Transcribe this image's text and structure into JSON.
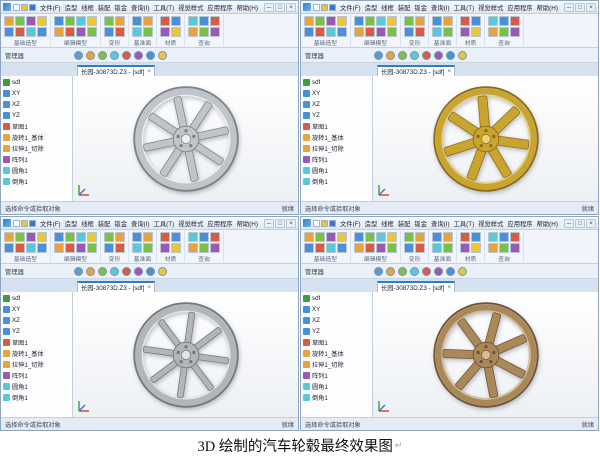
{
  "caption": {
    "text": "3D 绘制的汽车轮毂最终效果图",
    "mark": "↵"
  },
  "app": {
    "menus": [
      "文件(F)",
      "造型",
      "线框",
      "装配",
      "钣金",
      "查询(I)",
      "工具(T)",
      "视觉样式",
      "应用程序",
      "帮助(H)"
    ],
    "quick_icons": [
      {
        "name": "new-file-icon",
        "color": "#ffffff"
      },
      {
        "name": "open-file-icon",
        "color": "#f0c040"
      },
      {
        "name": "save-icon",
        "color": "#3a78c9"
      }
    ],
    "window_buttons": [
      "─",
      "□",
      "×"
    ],
    "ribbon": {
      "groups": [
        {
          "label": "基础造型",
          "icon_colors": [
            "#e8a33d",
            "#4a90d9",
            "#7ac143",
            "#d95b43",
            "#9b59b6",
            "#5bc8d9",
            "#e8c63d",
            "#4a90d9"
          ]
        },
        {
          "label": "编辑模型",
          "icon_colors": [
            "#4a90d9",
            "#e8a33d",
            "#7ac143",
            "#d95b43",
            "#5bc8d9",
            "#9b59b6",
            "#e8c63d",
            "#7ac143"
          ]
        },
        {
          "label": "变形",
          "icon_colors": [
            "#7ac143",
            "#4a90d9",
            "#e8a33d",
            "#d95b43"
          ]
        },
        {
          "label": "基准面",
          "icon_colors": [
            "#4a90d9",
            "#5bc8d9",
            "#e8a33d",
            "#7ac143"
          ]
        },
        {
          "label": "材质",
          "icon_colors": [
            "#d95b43",
            "#9b59b6",
            "#4a90d9",
            "#e8c63d"
          ]
        },
        {
          "label": "查询",
          "icon_colors": [
            "#5bc8d9",
            "#e8a33d",
            "#4a90d9",
            "#7ac143",
            "#d95b43",
            "#9b59b6"
          ]
        }
      ]
    },
    "view_icons": [
      {
        "name": "view-fit-icon",
        "color": "#5b9bd5"
      },
      {
        "name": "view-rotate-icon",
        "color": "#e8a33d"
      },
      {
        "name": "view-pan-icon",
        "color": "#7ac143"
      },
      {
        "name": "view-zoom-icon",
        "color": "#5bc8d9"
      },
      {
        "name": "view-front-icon",
        "color": "#d95b43"
      },
      {
        "name": "view-iso-icon",
        "color": "#9b59b6"
      },
      {
        "name": "view-shade-icon",
        "color": "#4a90d9"
      },
      {
        "name": "view-wireframe-icon",
        "color": "#e8c63d"
      }
    ],
    "panel": {
      "title": "管理器"
    },
    "tab_close": "×",
    "tree_items": [
      {
        "icon": "part-icon",
        "color": "#3a9e3a",
        "label": "sdf"
      },
      {
        "icon": "plane-icon",
        "color": "#4a90d9",
        "label": "XY"
      },
      {
        "icon": "plane-icon",
        "color": "#4a90d9",
        "label": "XZ"
      },
      {
        "icon": "plane-icon",
        "color": "#4a90d9",
        "label": "YZ"
      },
      {
        "icon": "sketch-icon",
        "color": "#d95b43",
        "label": "草图1"
      },
      {
        "icon": "feature-icon",
        "color": "#e8a33d",
        "label": "旋转1_基体"
      },
      {
        "icon": "feature-icon",
        "color": "#e8a33d",
        "label": "拉伸1_切除"
      },
      {
        "icon": "pattern-icon",
        "color": "#9b59b6",
        "label": "阵列1"
      },
      {
        "icon": "fillet-icon",
        "color": "#5bc8d9",
        "label": "圆角1"
      },
      {
        "icon": "chamfer-icon",
        "color": "#5bc8d9",
        "label": "倒角1"
      }
    ],
    "status": {
      "left": "选择命令或拾取对象",
      "right": "就绪"
    }
  },
  "windows": [
    {
      "id": "top-left",
      "tab_title": "长园-30873D.Z3 - [sdf]",
      "wheel": {
        "main": "#c0c5c9",
        "dark": "#7d8286",
        "light": "#eef0f1",
        "spokes": 8,
        "rotation": -12,
        "spoke_width": 8
      }
    },
    {
      "id": "top-right",
      "tab_title": "长园-30873D.Z3 - [sdf]",
      "wheel": {
        "main": "#c9a42e",
        "dark": "#8a6d14",
        "light": "#ead27a",
        "spokes": 7,
        "rotation": -5,
        "spoke_width": 10
      }
    },
    {
      "id": "bottom-left",
      "tab_title": "长园-30873D.Z3 - [sdf]",
      "wheel": {
        "main": "#b2b6ba",
        "dark": "#74787c",
        "light": "#e2e4e6",
        "spokes": 8,
        "rotation": 8,
        "spoke_width": 6.5
      }
    },
    {
      "id": "bottom-right",
      "tab_title": "长园-30873D.Z3 - [sdf]",
      "wheel": {
        "main": "#ab8858",
        "dark": "#6e5436",
        "light": "#d8bc94",
        "spokes": 7,
        "rotation": 15,
        "spoke_width": 9
      }
    }
  ]
}
